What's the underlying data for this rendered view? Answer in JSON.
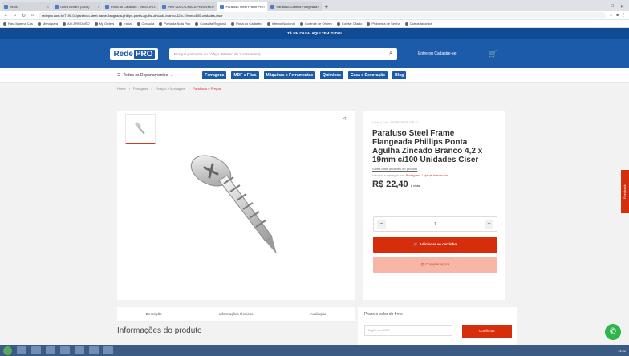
{
  "browser": {
    "tabs": [
      {
        "label": "Inbox"
      },
      {
        "label": "Outra Echaro (2303)"
      },
      {
        "label": "Porta do Cadastro - INRGORO"
      },
      {
        "label": "PAR LUCO CMALA PERAVMO"
      },
      {
        "label": "Parafuso Steel Frame Pro",
        "active": true
      },
      {
        "label": "Parafuso Cabeca Flangeada"
      }
    ],
    "url": "redepro.com.br/7190-01/parafuso-steel-frame-flangeada-phillips-ponta-agulha-zincado-branco-42-x-19mm-c100-unidades-ciser",
    "bookmarks": [
      "Para ligar na Cas",
      "Menu para",
      "ASI ARRONSO",
      "My Orders",
      "Inicial",
      "Consulta",
      "Porta da Nota Fisc",
      "Consulta Regional",
      "Porta do Cadastro",
      "Inferno Nacional",
      "Controle de Ordem",
      "Coletar Citado",
      "Problema de Senha",
      "Outros favoritos"
    ]
  },
  "site": {
    "banner": "TÁ EM CASA, AQUI TEM TUDO!",
    "logo_left": "Rede",
    "logo_right": "PRO",
    "search_placeholder": "Busque por nome ou código (Mínimo de 3 caracteres)",
    "login": "Entre ou Cadastre-se",
    "departments": "Todos os Departamentos",
    "categories": [
      "Ferragens",
      "MDF e Fitas",
      "Máquinas e Ferramentas",
      "Químicos",
      "Casa e Decoração",
      "Blog"
    ],
    "breadcrumb": [
      "Home",
      "Ferragens",
      "Fixação e Montagem",
      "Parafusos e Pregos"
    ]
  },
  "product": {
    "brand_code": "Ciser | Cód. 2972849174 100 11",
    "title": "Parafuso Steel Frame Flangeada Phillips Ponta Agulha Zincado Branco 4,2 x 19mm c/100 Unidades Ciser",
    "more_details": "Saiba mais detalhes do produto",
    "seller": "Vendido e entregue por:",
    "seller_name": "Rodrigues - Loja de marcenaria",
    "price": "R$ 22,40",
    "price_suffix": "à vista",
    "qty": "1",
    "add_to_cart": "Adicionar ao carrinho",
    "buy_now": "Comprar agora"
  },
  "tabs": [
    "Descrição",
    "Informações técnicas",
    "Avaliação"
  ],
  "shipping": {
    "label": "Prazo e valor do frete",
    "placeholder": "Digite seu CEP",
    "button": "Confirmar"
  },
  "section_title": "Informações do produto",
  "feedback": "Feedback",
  "clock": "14:42"
}
